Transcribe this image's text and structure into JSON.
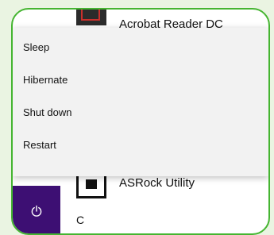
{
  "background_apps": {
    "acrobat_label": "Acrobat Reader DC",
    "asrock_label": "ASRock Utility",
    "section_letter": "C"
  },
  "power_menu": {
    "items": [
      {
        "label": "Sleep"
      },
      {
        "label": "Hibernate"
      },
      {
        "label": "Shut down"
      },
      {
        "label": "Restart"
      }
    ]
  },
  "colors": {
    "frame_border": "#45b531",
    "power_tile_bg": "#3d0f73",
    "menu_bg": "#f2f2f2",
    "page_bg": "#eaf4e2"
  },
  "icons": {
    "power": "power-icon",
    "acrobat": "acrobat-app-icon",
    "asrock": "asrock-app-icon"
  }
}
